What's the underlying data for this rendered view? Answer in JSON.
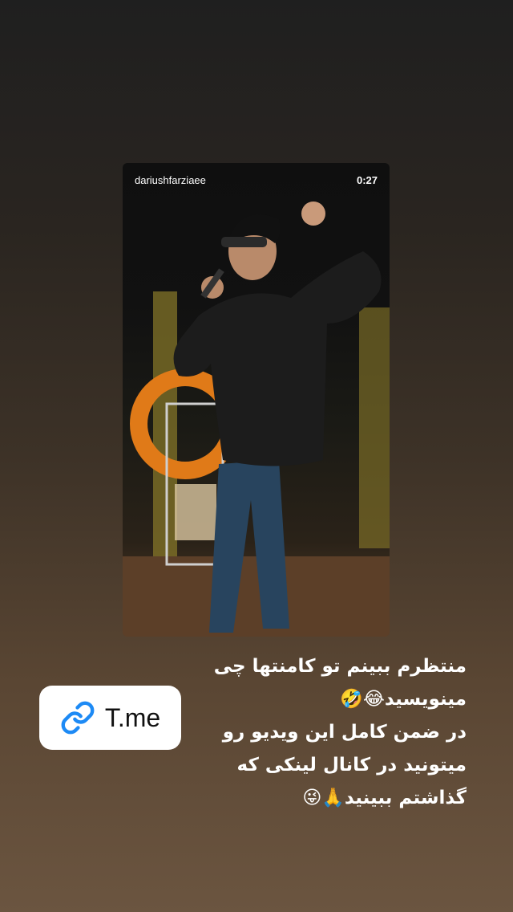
{
  "story": {
    "video": {
      "username": "dariushfarziaee",
      "duration": "0:27"
    },
    "link_sticker": {
      "icon": "link-icon",
      "label": "T.me",
      "icon_color": "#1d8af5"
    },
    "caption_lines": [
      "منتظرم ببینم تو کامنتها چی",
      "مینویسید😂🤣",
      "در ضمن کامل این ویدیو رو",
      "میتونید در کانال لینکی که",
      "گذاشتم ببینید🙏😜"
    ]
  }
}
